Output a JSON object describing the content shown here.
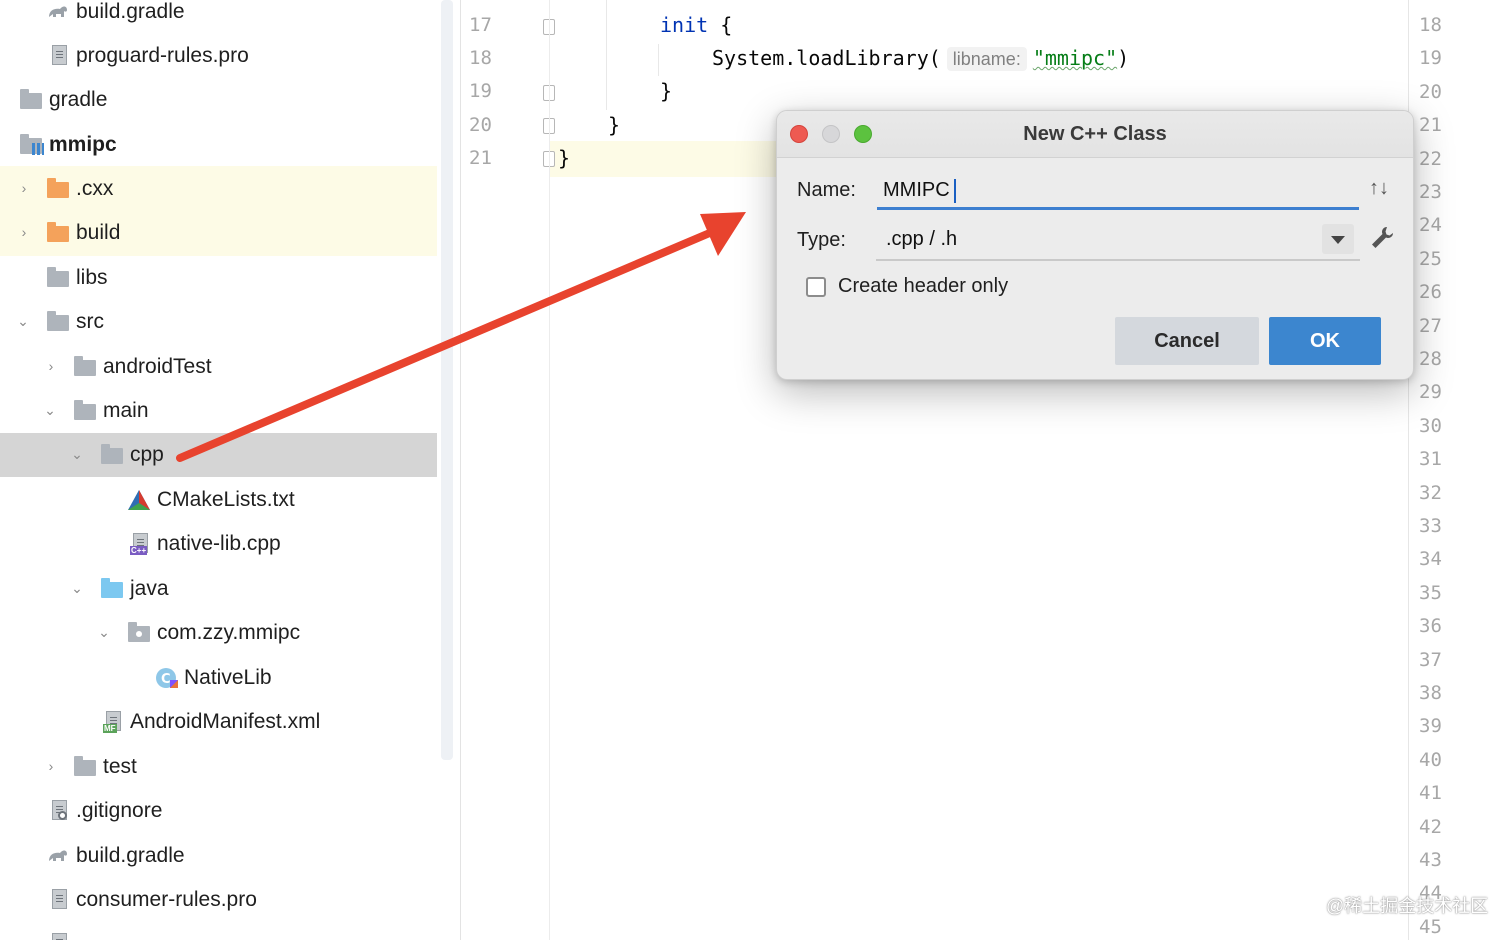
{
  "tree": {
    "items": [
      {
        "label": "build.gradle",
        "icon": "gradle-icon"
      },
      {
        "label": "proguard-rules.pro",
        "icon": "file-icon"
      },
      {
        "label": "gradle",
        "icon": "folder-icon"
      },
      {
        "label": "mmipc",
        "icon": "module-folder-icon"
      },
      {
        "label": ".cxx",
        "icon": "folder-excluded-icon"
      },
      {
        "label": "build",
        "icon": "folder-excluded-icon"
      },
      {
        "label": "libs",
        "icon": "folder-icon"
      },
      {
        "label": "src",
        "icon": "folder-icon"
      },
      {
        "label": "androidTest",
        "icon": "folder-icon"
      },
      {
        "label": "main",
        "icon": "folder-icon"
      },
      {
        "label": "cpp",
        "icon": "folder-icon"
      },
      {
        "label": "CMakeLists.txt",
        "icon": "cmake-icon"
      },
      {
        "label": "native-lib.cpp",
        "icon": "cpp-file-icon"
      },
      {
        "label": "java",
        "icon": "source-folder-icon"
      },
      {
        "label": "com.zzy.mmipc",
        "icon": "package-icon"
      },
      {
        "label": "NativeLib",
        "icon": "kotlin-class-icon"
      },
      {
        "label": "AndroidManifest.xml",
        "icon": "manifest-icon"
      },
      {
        "label": "test",
        "icon": "folder-icon"
      },
      {
        "label": ".gitignore",
        "icon": "gitignore-icon"
      },
      {
        "label": "build.gradle",
        "icon": "gradle-icon"
      },
      {
        "label": "consumer-rules.pro",
        "icon": "file-icon"
      }
    ],
    "selected": "cpp"
  },
  "editor": {
    "line_numbers": [
      "17",
      "18",
      "19",
      "20",
      "21"
    ],
    "code": {
      "init_kw": "init",
      "init_rest": " {",
      "load_call": "System.loadLibrary(",
      "param_hint": "libname:",
      "lib_string": "\"mmipc\"",
      "close_paren": ")",
      "brace_inner": "}",
      "brace_outer": "}",
      "brace_file": "}"
    },
    "right_line_numbers": [
      "18",
      "19",
      "20",
      "21",
      "22",
      "23",
      "24",
      "25",
      "26",
      "27",
      "28",
      "29",
      "30",
      "31",
      "32",
      "33",
      "34",
      "35",
      "36",
      "37",
      "38",
      "39",
      "40",
      "41",
      "42",
      "43",
      "44",
      "45"
    ]
  },
  "dialog": {
    "title": "New C++ Class",
    "name_label": "Name:",
    "name_value": "MMIPC",
    "type_label": "Type:",
    "type_value": ".cpp / .h",
    "checkbox_label": "Create header only",
    "checkbox_checked": false,
    "cancel_label": "Cancel",
    "ok_label": "OK"
  },
  "colors": {
    "selection_row": "#d5d5d5",
    "excluded_row": "#fdfbe6",
    "accent_blue": "#3c86cf",
    "arrow_red": "#e8432e"
  },
  "watermark": "@稀土掘金技术社区"
}
